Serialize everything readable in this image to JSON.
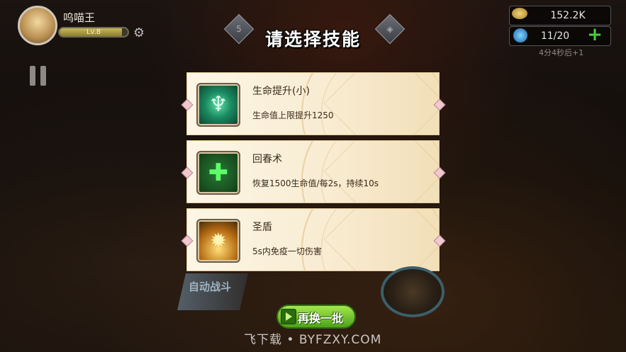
{
  "player": {
    "name": "呜喵王",
    "level": "Lv.8",
    "avatar_icon": "player-avatar"
  },
  "resources": {
    "gold": "152.2K",
    "energy": "11/20",
    "regen_timer": "4分4秒后+1",
    "gold_icon": "coin-icon",
    "energy_icon": "energy-drop-icon"
  },
  "dialog": {
    "title": "请选择技能",
    "left_badge": "5",
    "skills": [
      {
        "name": "生命提升(小)",
        "desc": "生命值上限提升1250",
        "icon": "tree-icon"
      },
      {
        "name": "回春术",
        "desc": "恢复1500生命值/每2s，持续10s",
        "icon": "cross-icon"
      },
      {
        "name": "圣盾",
        "desc": "5s内免疫一切伤害",
        "icon": "shield-icon"
      }
    ],
    "refresh_label": "再换一批"
  },
  "controls": {
    "auto_battle": "自动战斗"
  },
  "watermark": "飞下载 • BYFZXY.COM",
  "colors": {
    "card_bg": "#f8ecd2",
    "button_green": "#7ccd2e",
    "title_text": "#ffffff"
  }
}
